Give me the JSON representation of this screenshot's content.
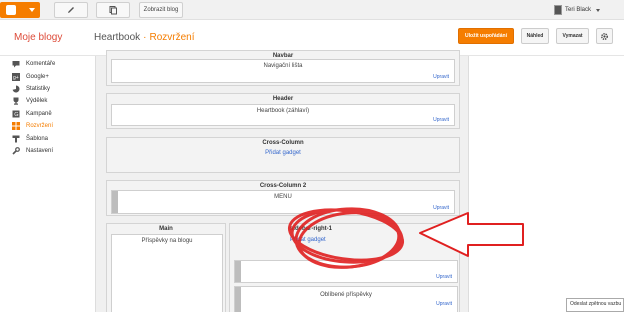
{
  "topbar": {
    "view_blog_label": "Zobrazit blog",
    "user_name": "Teri Black"
  },
  "header": {
    "my_blogs": "Moje blogy",
    "blog_name": "Heartbook",
    "separator": "·",
    "page_name": "Rozvržení",
    "save_label": "Uložit uspořádání",
    "preview_label": "Náhled",
    "clear_label": "Vymazat"
  },
  "sidebar": {
    "items": [
      {
        "label": "Komentáře",
        "icon": "comment-icon"
      },
      {
        "label": "Google+",
        "icon": "google-plus-icon"
      },
      {
        "label": "Statistiky",
        "icon": "stats-icon"
      },
      {
        "label": "Výdělek",
        "icon": "trophy-icon"
      },
      {
        "label": "Kampaně",
        "icon": "campaign-icon"
      },
      {
        "label": "Rozvržení",
        "icon": "layout-icon",
        "active": true
      },
      {
        "label": "Šablona",
        "icon": "template-icon"
      },
      {
        "label": "Nastavení",
        "icon": "wrench-icon"
      }
    ]
  },
  "layout": {
    "navbar": {
      "title": "Navbar",
      "gadget": "Navigační lišta",
      "edit": "Upravit"
    },
    "header": {
      "title": "Header",
      "gadget": "Heartbook (záhlaví)",
      "edit": "Upravit"
    },
    "cross_column": {
      "title": "Cross-Column",
      "add": "Přidat gadget"
    },
    "cross_column_2": {
      "title": "Cross-Column 2",
      "gadget": "MENU",
      "edit": "Upravit"
    },
    "main": {
      "title": "Main",
      "gadget": "Příspěvky na blogu"
    },
    "sidebar_right": {
      "title": "sidebar-right-1",
      "add": "Přidat gadget",
      "gadget1_edit": "Upravit",
      "gadget2": "Oblíbené příspěvky",
      "gadget2_edit": "Upravit"
    }
  },
  "tooltip": "Odeslat zpětnou vazbu",
  "colors": {
    "accent": "#f57d00",
    "link": "#3366cc",
    "annotation": "#e02020"
  }
}
